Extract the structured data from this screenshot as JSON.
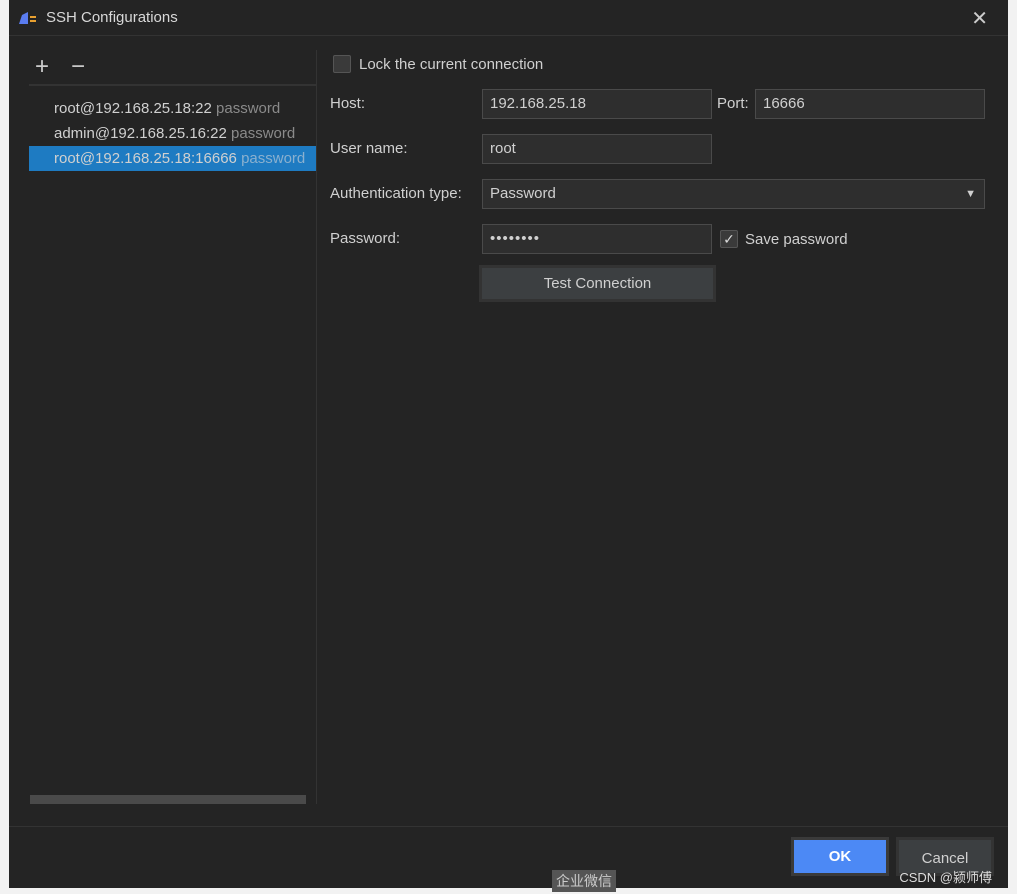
{
  "window": {
    "title": "SSH Configurations",
    "close": "✕"
  },
  "toolbar": {
    "add": "+",
    "remove": "−"
  },
  "connections": [
    {
      "name": "root@192.168.25.18:22",
      "type": "password",
      "selected": false
    },
    {
      "name": "admin@192.168.25.16:22",
      "type": "password",
      "selected": false
    },
    {
      "name": "root@192.168.25.18:16666",
      "type": "password",
      "selected": true
    }
  ],
  "form": {
    "lock_label": "Lock the current connection",
    "lock_checked": false,
    "host_label": "Host:",
    "host": "192.168.25.18",
    "port_label": "Port:",
    "port": "16666",
    "user_label": "User name:",
    "user": "root",
    "auth_label": "Authentication type:",
    "auth": "Password",
    "password_label": "Password:",
    "password": "••••••••",
    "save_label": "Save password",
    "save_checked": true,
    "test_label": "Test Connection"
  },
  "footer": {
    "ok": "OK",
    "cancel": "Cancel"
  },
  "watermark": "CSDN @颍师傅",
  "taskbar_label": "企业微信",
  "colors": {
    "accent": "#4c89f5",
    "selection": "#1e7bc2",
    "background": "#242424"
  }
}
